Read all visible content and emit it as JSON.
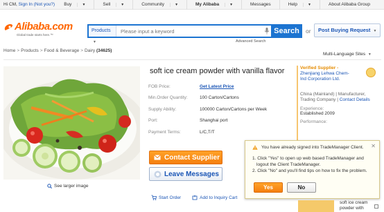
{
  "topbar": {
    "greeting": "Hi CM,",
    "signin": "Sign In",
    "notyou": "(Not you?)",
    "nav": [
      "Buy",
      "Sell",
      "Community",
      "My Alibaba",
      "Messages",
      "Help",
      "About Alibaba Group"
    ]
  },
  "header": {
    "logo_text": "Alibaba.com",
    "logo_tagline": "Global trade starts here.™",
    "search_category": "Products",
    "search_placeholder": "Please input a keyword",
    "search_button": "Search",
    "advanced_search": "Advanced Search",
    "or_text": "or",
    "post_buying_request": "Post Buying Request"
  },
  "breadcrumb": {
    "items": [
      "Home",
      "Products",
      "Food & Beverage",
      "Dairy"
    ],
    "count": "(34625)",
    "multi_language": "Multi-Language Sites"
  },
  "product": {
    "title": "soft ice cream powder with vanilla flavor",
    "see_larger": "See larger image",
    "specs": [
      {
        "key": "FOB Price:",
        "value": "Get Latest Price"
      },
      {
        "key": "Min.Order Quantity:",
        "value": "100 Carton/Cartons"
      },
      {
        "key": "Supply Ability:",
        "value": "100000 Carton/Cartons per Week"
      },
      {
        "key": "Port:",
        "value": "Shanghai port"
      },
      {
        "key": "Payment Terms:",
        "value": "L/C,T/T"
      }
    ],
    "contact_button": "Contact Supplier",
    "leave_button": "Leave Messages",
    "start_order": "Start Order",
    "add_inquiry": "Add to Inquiry Cart"
  },
  "supplier": {
    "verified_label": "Verified Supplier -",
    "name_line1": "Zhenjiang Lehwa Chem-",
    "name_line2": "Ind Corporation Ltd.",
    "loc_line1": "China (Mainland) | Manufacturer,",
    "loc_line2": "Trading Company |",
    "contact_details": "Contact Details",
    "experience_label": "Experience:",
    "established": "Established 2009",
    "performance_label": "Performance:"
  },
  "dialog": {
    "title": "You have already signed into TradeManager Client.",
    "line1a": "1. Click \"Yes\" to open up web based TradeManager and",
    "line1b": "logout the Client TradeManager.",
    "line2": "2. Click \"No\" and you'll find tips on how to fix the problem.",
    "yes": "Yes",
    "no": "No"
  },
  "card": {
    "line1": "soft ice cream",
    "line2": "powder with"
  },
  "colors": {
    "brand_orange": "#ff6600",
    "search_blue": "#1c74d1",
    "link_blue": "#1a55b5"
  }
}
